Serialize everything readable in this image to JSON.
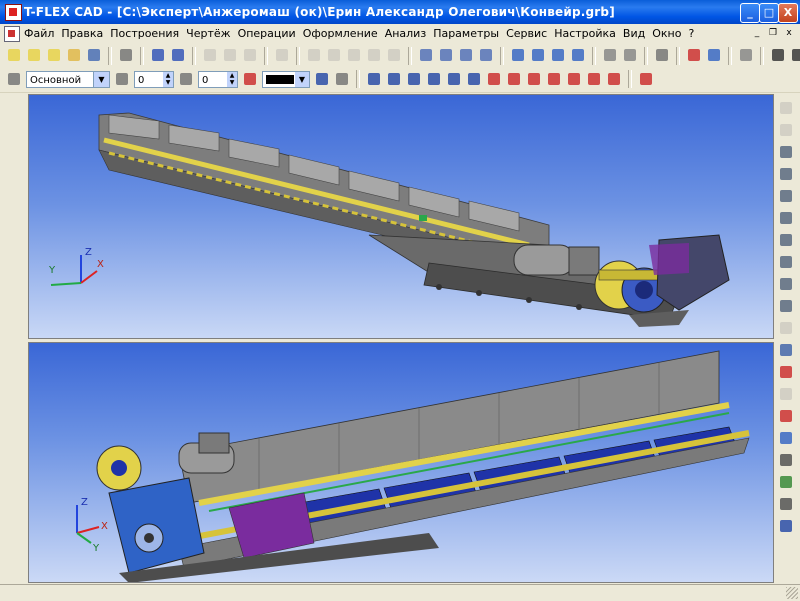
{
  "window": {
    "title": "T-FLEX CAD - [C:\\Эксперт\\Анжеромаш (ок)\\Ерин Александр Олегович\\Конвейр.grb]",
    "min_label": "_",
    "max_label": "□",
    "close_label": "X"
  },
  "menu": {
    "items": [
      "Файл",
      "Правка",
      "Построения",
      "Чертёж",
      "Операции",
      "Оформление",
      "Анализ",
      "Параметры",
      "Сервис",
      "Настройка",
      "Вид",
      "Окно",
      "?"
    ],
    "mdi_min": "_",
    "mdi_restore": "❐",
    "mdi_close": "x"
  },
  "toolbar2": {
    "layer_value": "Основной",
    "level_value": "0",
    "priority_value": "0",
    "color_value": "#000000"
  },
  "viewport_top": {
    "axis_z": "Z",
    "axis_y": "Y",
    "axis_x": "X",
    "bg_top": "#3A67D6",
    "bg_bottom": "#C9D8F6"
  },
  "viewport_bottom": {
    "axis_z": "Z",
    "axis_y": "Y",
    "axis_x": "X"
  },
  "colors": {
    "titlebar": "#0055E5",
    "chrome": "#ECE9D8",
    "model_gray": "#8C8C8C",
    "model_yellow": "#E2D24A",
    "model_blue": "#1F33A8",
    "model_purple": "#7A2C9E"
  }
}
